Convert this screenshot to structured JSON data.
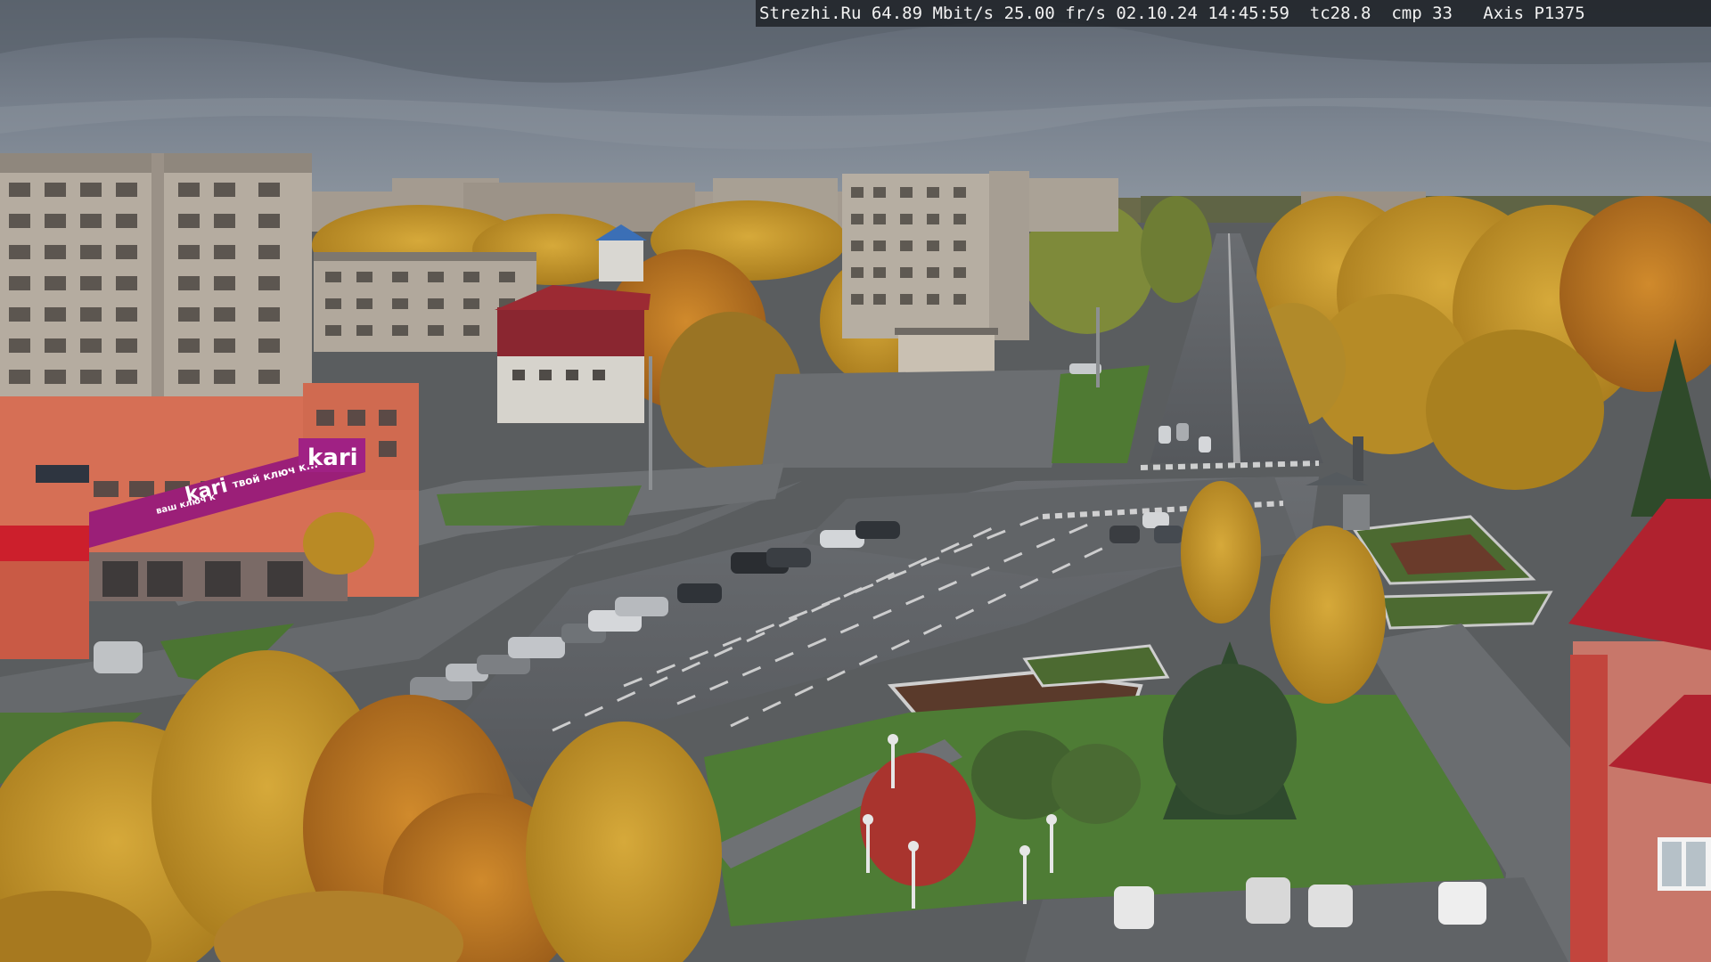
{
  "osd": {
    "source": "Strezhi.Ru",
    "bitrate": "64.89 Mbit/s",
    "framerate": "25.00 fr/s",
    "date": "02.10.24",
    "time": "14:45:59",
    "tc": "tc28.8",
    "cmp": "cmp 33",
    "camera": "Axis P1375"
  },
  "signs": {
    "kari_upper": "kari",
    "kari_lower": "kari",
    "kari_slogan": "твой ключ к...",
    "kari_slogan_left": "ваш ключ к"
  },
  "colors": {
    "sky": "#717a86",
    "foliage_yellow": "#c89a2a",
    "foliage_orange": "#b8741f",
    "road": "#5d6064",
    "grass": "#4d7a34",
    "kari_magenta": "#9b1f78",
    "roof_red": "#b0222f"
  }
}
